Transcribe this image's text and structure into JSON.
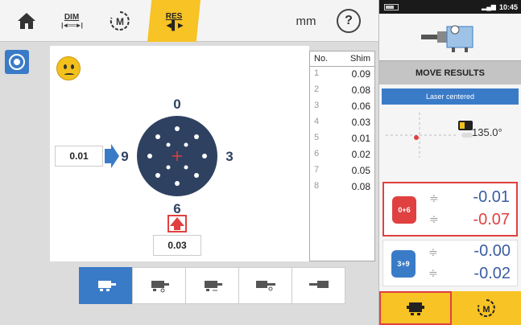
{
  "topbar": {
    "dim_label": "DIM",
    "res_label": "RES",
    "unit": "mm",
    "help": "?"
  },
  "diagram": {
    "clock_top": "0",
    "clock_right": "3",
    "clock_bottom": "6",
    "clock_left": "9",
    "left_value": "0.01",
    "bottom_value": "0.03"
  },
  "shim_table": {
    "col_no": "No.",
    "col_shim": "Shim",
    "rows": [
      {
        "no": "1",
        "shim": "0.09"
      },
      {
        "no": "2",
        "shim": "0.08"
      },
      {
        "no": "3",
        "shim": "0.06"
      },
      {
        "no": "4",
        "shim": "0.03"
      },
      {
        "no": "5",
        "shim": "0.01"
      },
      {
        "no": "6",
        "shim": "0.02"
      },
      {
        "no": "7",
        "shim": "0.05"
      },
      {
        "no": "8",
        "shim": "0.08"
      }
    ]
  },
  "statusbar": {
    "time": "10:45"
  },
  "right_panel": {
    "title": "MOVE RESULTS",
    "laser_status": "Laser centered",
    "angle": "135.0°",
    "vertical": {
      "badge": "0+6",
      "front": "-0.01",
      "back": "-0.07"
    },
    "horizontal": {
      "badge": "3+9",
      "front": "-0.00",
      "back": "-0.02"
    }
  },
  "colors": {
    "accent_blue": "#3a7bc8",
    "highlight_yellow": "#f7c325",
    "alert_red": "#e04040",
    "dark_navy": "#2f4160"
  }
}
